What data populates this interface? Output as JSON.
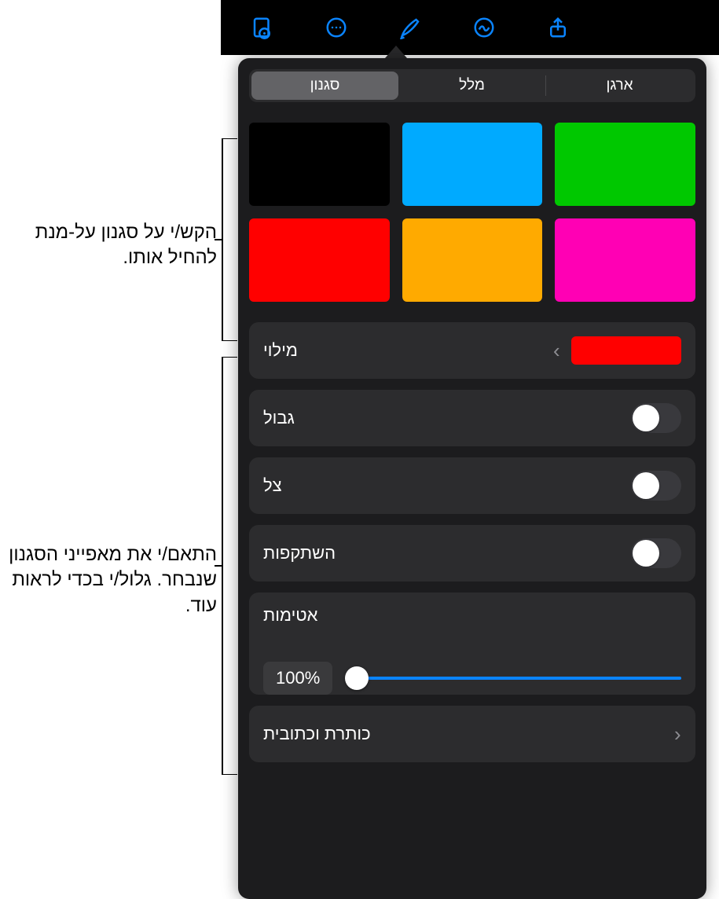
{
  "toolbar": {
    "icons": [
      "document-view-icon",
      "more-icon",
      "paintbrush-icon",
      "insert-icon",
      "share-icon"
    ]
  },
  "tabs": {
    "style": "סגנון",
    "text": "מלל",
    "arrange": "ארגן",
    "selected": "style"
  },
  "swatch_colors": [
    "#00c800",
    "#00aaff",
    "#000000",
    "#ff00b4",
    "#ffaa00",
    "#ff0000"
  ],
  "fill": {
    "label": "מילוי",
    "color": "#ff0000"
  },
  "border": {
    "label": "גבול",
    "on": false
  },
  "shadow": {
    "label": "צל",
    "on": false
  },
  "reflection": {
    "label": "השתקפות",
    "on": false
  },
  "opacity": {
    "label": "אטימות",
    "value_text": "100%"
  },
  "title_caption": {
    "label": "כותרת וכתובית"
  },
  "callouts": {
    "style_tap": "הקש/י על סגנון על-מנת להחיל אותו.",
    "style_adjust": "התאם/י את מאפייני הסגנון שנבחר. גלול/י בכדי לראות עוד."
  }
}
